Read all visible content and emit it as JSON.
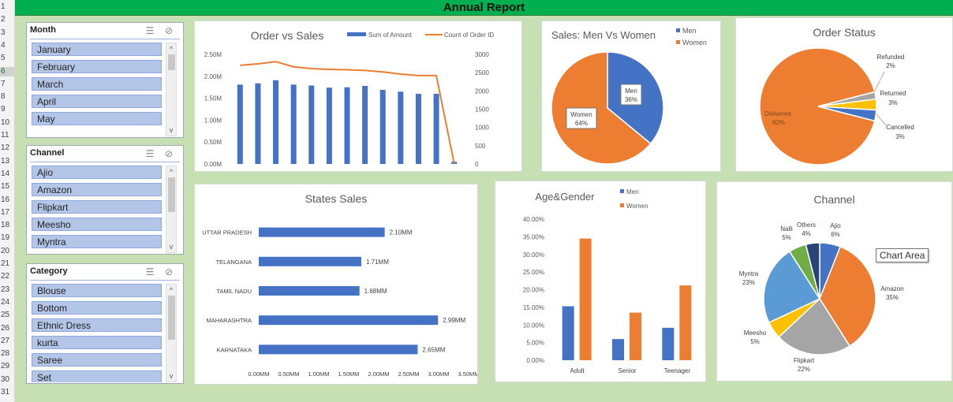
{
  "title": "Annual Report",
  "row_numbers": [
    "1",
    "2",
    "3",
    "4",
    "5",
    "6",
    "7",
    "8",
    "9",
    "10",
    "11",
    "12",
    "13",
    "14",
    "15",
    "16",
    "17",
    "18",
    "19",
    "20",
    "21",
    "22",
    "23",
    "24",
    "25",
    "26",
    "27",
    "28",
    "29",
    "30",
    "31"
  ],
  "slicers": {
    "month": {
      "header": "Month",
      "items": [
        "January",
        "February",
        "March",
        "April",
        "May"
      ]
    },
    "channel": {
      "header": "Channel",
      "items": [
        "Ajio",
        "Amazon",
        "Flipkart",
        "Meesho",
        "Myntra"
      ]
    },
    "category": {
      "header": "Category",
      "items": [
        "Blouse",
        "Bottom",
        "Ethnic Dress",
        "kurta",
        "Saree",
        "Set"
      ]
    }
  },
  "icons": {
    "multiselect": "multiselect-icon",
    "clear_filter": "clear-filter-icon"
  },
  "tooltip": "Chart Area",
  "colors": {
    "blue": "#4472c4",
    "orange": "#ed7d31",
    "gray": "#a5a5a5",
    "yellow": "#ffc000",
    "lightblue": "#5b9bd5",
    "green": "#70ad47",
    "navy": "#264478",
    "title_green": "#00b050",
    "background": "#c6e0b4"
  },
  "chart_data": [
    {
      "id": "order_vs_sales",
      "type": "bar",
      "title": "Order vs Sales",
      "series": [
        {
          "name": "Sum of Amount",
          "kind": "bar",
          "axis": "left",
          "values": [
            1.81,
            1.84,
            1.91,
            1.81,
            1.79,
            1.74,
            1.75,
            1.78,
            1.69,
            1.65,
            1.6,
            1.6,
            0.05
          ]
        },
        {
          "name": "Count of Order ID",
          "kind": "line",
          "axis": "right",
          "values": [
            2700,
            2740,
            2800,
            2660,
            2610,
            2590,
            2580,
            2560,
            2520,
            2460,
            2420,
            2420,
            10
          ]
        }
      ],
      "y_left_ticks": [
        "0.00M",
        "0.50M",
        "1.00M",
        "1.50M",
        "2.00M",
        "2.50M"
      ],
      "y_right_ticks": [
        "0",
        "500",
        "1000",
        "1500",
        "2000",
        "2500",
        "3000"
      ],
      "ylim_left": [
        0,
        2.5
      ],
      "ylim_right": [
        0,
        3000
      ]
    },
    {
      "id": "sales_men_vs_women",
      "type": "pie",
      "title": "Sales: Men Vs Women",
      "legend": [
        "Men",
        "Women"
      ],
      "slices": [
        {
          "label": "Men",
          "value": 36,
          "text": "36%"
        },
        {
          "label": "Women",
          "value": 64,
          "text": "64%"
        }
      ]
    },
    {
      "id": "order_status",
      "type": "pie",
      "title": "Order Status",
      "slices": [
        {
          "label": "Delivered",
          "value": 92,
          "text": "92%"
        },
        {
          "label": "Refunded",
          "value": 2,
          "text": "2%"
        },
        {
          "label": "Returned",
          "value": 3,
          "text": "3%"
        },
        {
          "label": "Cancelled",
          "value": 3,
          "text": "3%"
        }
      ]
    },
    {
      "id": "states_sales",
      "type": "bar",
      "title": "States Sales",
      "categories": [
        "UTTAR PRADESH",
        "TELANGANA",
        "TAMIL NADU",
        "MAHARASHTRA",
        "KARNATAKA"
      ],
      "values": [
        2.1,
        1.71,
        1.68,
        2.99,
        2.65
      ],
      "value_labels": [
        "2.10MM",
        "1.71MM",
        "1.68MM",
        "2.99MM",
        "2.65MM"
      ],
      "x_ticks": [
        "0.00MM",
        "0.50MM",
        "1.00MM",
        "1.50MM",
        "2.00MM",
        "2.50MM",
        "3.00MM",
        "3.50MM"
      ],
      "xlim": [
        0,
        3.5
      ]
    },
    {
      "id": "age_gender",
      "type": "bar",
      "title": "Age&Gender",
      "categories": [
        "Adult",
        "Senior",
        "Teenager"
      ],
      "series": [
        {
          "name": "Men",
          "values": [
            15.3,
            6.0,
            9.2
          ]
        },
        {
          "name": "Women",
          "values": [
            34.5,
            13.5,
            21.2
          ]
        }
      ],
      "y_ticks": [
        "0.00%",
        "5.00%",
        "10.00%",
        "15.00%",
        "20.00%",
        "25.00%",
        "30.00%",
        "35.00%",
        "40.00%"
      ],
      "ylim": [
        0,
        40
      ]
    },
    {
      "id": "channel",
      "type": "pie",
      "title": "Channel",
      "slices": [
        {
          "label": "Ajio",
          "value": 6,
          "text": "6%"
        },
        {
          "label": "Amazon",
          "value": 35,
          "text": "35%"
        },
        {
          "label": "Flipkart",
          "value": 22,
          "text": "22%"
        },
        {
          "label": "Meesho",
          "value": 5,
          "text": "5%"
        },
        {
          "label": "Myntra",
          "value": 23,
          "text": "23%"
        },
        {
          "label": "Nalli",
          "value": 5,
          "text": "5%"
        },
        {
          "label": "Others",
          "value": 4,
          "text": "4%"
        }
      ]
    }
  ]
}
